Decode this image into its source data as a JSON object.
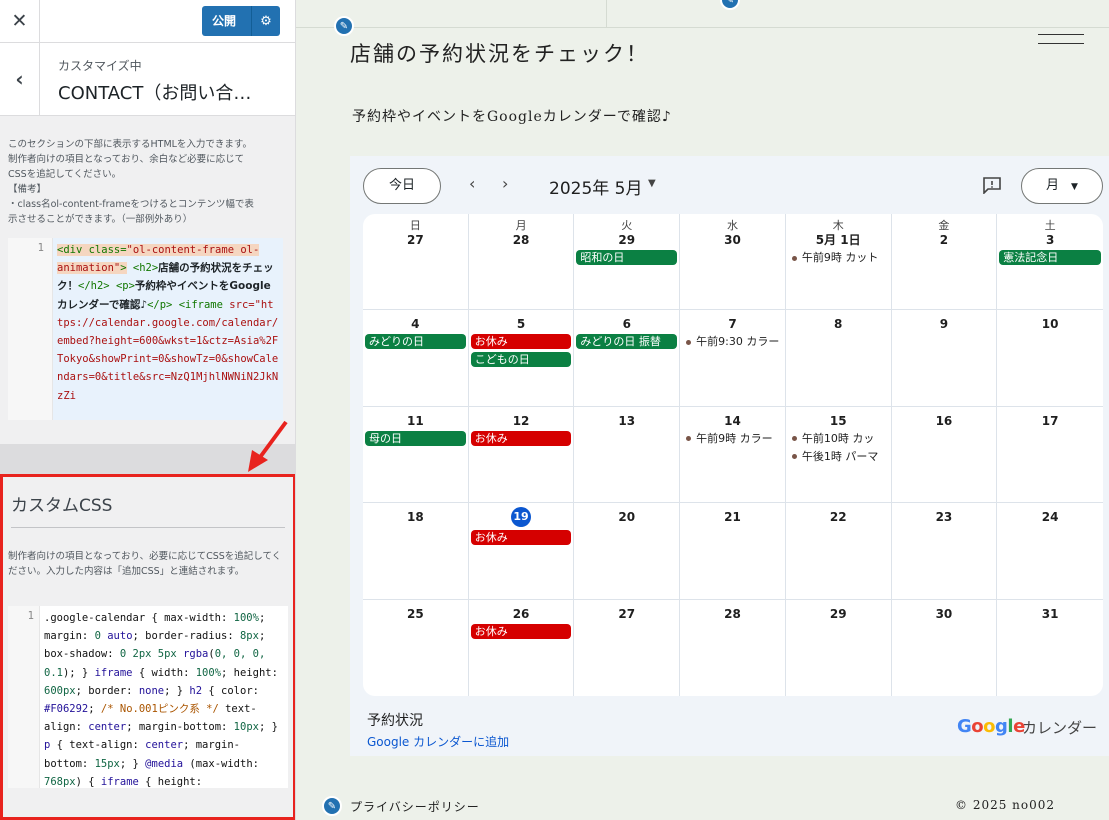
{
  "sidebar": {
    "close_icon": "close-icon",
    "publish_label": "公開",
    "back_icon": "chevron-left-icon",
    "customizing_label": "カスタマイズ中",
    "section_title": "CONTACT（お問い合…",
    "description_lines": [
      "このセクションの下部に表示するHTMLを入力できます。",
      "制作者向けの項目となっており、余白など必要に応じて",
      "CSSを追記してください。",
      "【備考】",
      "・class名ol-content-frameをつけるとコンテンツ幅で表",
      "示させることができます。（一部例外あり）"
    ],
    "html_editor": {
      "line_number": "1",
      "c1": "<div class=",
      "c2": "\"ol-content-frame ol-animation\"",
      "c3": ">",
      "c4": "<h2>",
      "c5": "店舗の予約状況をチェック！",
      "c6": "</h2>",
      "c7": "<p>",
      "c8": "予約枠やイベントをGoogleカレンダーで確認♪",
      "c9": "</p>",
      "c10": "<iframe",
      "c11": "src=\"https://calendar.google.com/calendar/embed?height=600&wkst=1&ctz=Asia%2FTokyo&showPrint=0&showTz=0&showCalendars=0&title&src=NzQ1MjhlNWNiN2JkNzZi"
    },
    "custom_css": {
      "title": "カスタムCSS",
      "description": "制作者向けの項目となっており、必要に応じてCSSを追記してください。入力した内容は「追加CSS」と連結されます。",
      "line_number": "1",
      "t1": ".google-calendar { max-width: ",
      "t2": "100%",
      "t3": "; margin: ",
      "t4": "0",
      "t5": " auto",
      "t6": "; border-radius: ",
      "t7": "8px",
      "t8": "; box-shadow: ",
      "t9": "0 2px 5px",
      "t10": " rgba",
      "t11": "(",
      "t12": "0, 0, 0, 0.1",
      "t13": "); } ",
      "t14": "iframe",
      "t15": " { width: ",
      "t16": "100%",
      "t17": "; height: ",
      "t18": "600px",
      "t19": "; border: ",
      "t20": "none",
      "t21": "; } ",
      "t22": "h2",
      "t23": " { color: ",
      "t24": "#F06292",
      "t25": "; ",
      "t26": "/* No.001ピンク系 */",
      "t27": " text-align: ",
      "t28": "center",
      "t29": "; margin-bottom: ",
      "t30": "10px",
      "t31": "; } ",
      "t32": "p",
      "t33": " { text-align: ",
      "t34": "center",
      "t35": "; margin-bottom: ",
      "t36": "15px",
      "t37": "; } ",
      "t38": "@media",
      "t39": " (max-width: ",
      "t40": "768px",
      "t41": ") { ",
      "t42": "iframe",
      "t43": " { height:"
    }
  },
  "preview": {
    "page_title": "店舗の予約状況をチェック！",
    "page_subtitle": "予約枠やイベントをGoogleカレンダーで確認♪",
    "calendar": {
      "today_label": "今日",
      "month_label": "2025年 5月",
      "view_label": "月",
      "weekdays": [
        "日",
        "月",
        "火",
        "水",
        "木",
        "金",
        "土"
      ],
      "weeks": [
        [
          {
            "d": "27",
            "events": []
          },
          {
            "d": "28",
            "events": []
          },
          {
            "d": "29",
            "events": [
              {
                "t": "昭和の日",
                "c": "green"
              }
            ]
          },
          {
            "d": "30",
            "events": []
          },
          {
            "d": "5月 1日",
            "events": [
              {
                "t": "午前9時 カット",
                "c": "dot"
              }
            ]
          },
          {
            "d": "2",
            "events": []
          },
          {
            "d": "3",
            "events": [
              {
                "t": "憲法記念日",
                "c": "green"
              }
            ]
          }
        ],
        [
          {
            "d": "4",
            "events": [
              {
                "t": "みどりの日",
                "c": "green"
              }
            ]
          },
          {
            "d": "5",
            "events": [
              {
                "t": "お休み",
                "c": "red"
              },
              {
                "t": "こどもの日",
                "c": "green"
              }
            ]
          },
          {
            "d": "6",
            "events": [
              {
                "t": "みどりの日 振替",
                "c": "green"
              }
            ]
          },
          {
            "d": "7",
            "events": [
              {
                "t": "午前9:30 カラー",
                "c": "dot"
              }
            ]
          },
          {
            "d": "8",
            "events": []
          },
          {
            "d": "9",
            "events": []
          },
          {
            "d": "10",
            "events": []
          }
        ],
        [
          {
            "d": "11",
            "events": [
              {
                "t": "母の日",
                "c": "green"
              }
            ]
          },
          {
            "d": "12",
            "events": [
              {
                "t": "お休み",
                "c": "red"
              }
            ]
          },
          {
            "d": "13",
            "events": []
          },
          {
            "d": "14",
            "events": [
              {
                "t": "午前9時 カラー",
                "c": "dot"
              }
            ]
          },
          {
            "d": "15",
            "events": [
              {
                "t": "午前10時 カッ",
                "c": "dot"
              },
              {
                "t": "午後1時 パーマ",
                "c": "dot"
              }
            ]
          },
          {
            "d": "16",
            "events": []
          },
          {
            "d": "17",
            "events": []
          }
        ],
        [
          {
            "d": "18",
            "events": []
          },
          {
            "d": "19",
            "today": true,
            "events": [
              {
                "t": "お休み",
                "c": "red"
              }
            ]
          },
          {
            "d": "20",
            "events": []
          },
          {
            "d": "21",
            "events": []
          },
          {
            "d": "22",
            "events": []
          },
          {
            "d": "23",
            "events": []
          },
          {
            "d": "24",
            "events": []
          }
        ],
        [
          {
            "d": "25",
            "events": []
          },
          {
            "d": "26",
            "events": [
              {
                "t": "お休み",
                "c": "red"
              }
            ]
          },
          {
            "d": "27",
            "events": []
          },
          {
            "d": "28",
            "events": []
          },
          {
            "d": "29",
            "events": []
          },
          {
            "d": "30",
            "events": []
          },
          {
            "d": "31",
            "events": []
          }
        ]
      ],
      "footer_title": "予約状況",
      "add_link": "Google カレンダーに追加",
      "logo_text": "Google",
      "logo_suffix": "カレンダー"
    },
    "privacy_label": "プライバシーポリシー",
    "copyright": "© 2025 no002"
  },
  "colors": {
    "publish_blue": "#2271b1",
    "highlight_red": "#e8231e",
    "holiday_green": "#0b8043",
    "closed_red": "#d50000",
    "today_blue": "#0b57d0"
  }
}
